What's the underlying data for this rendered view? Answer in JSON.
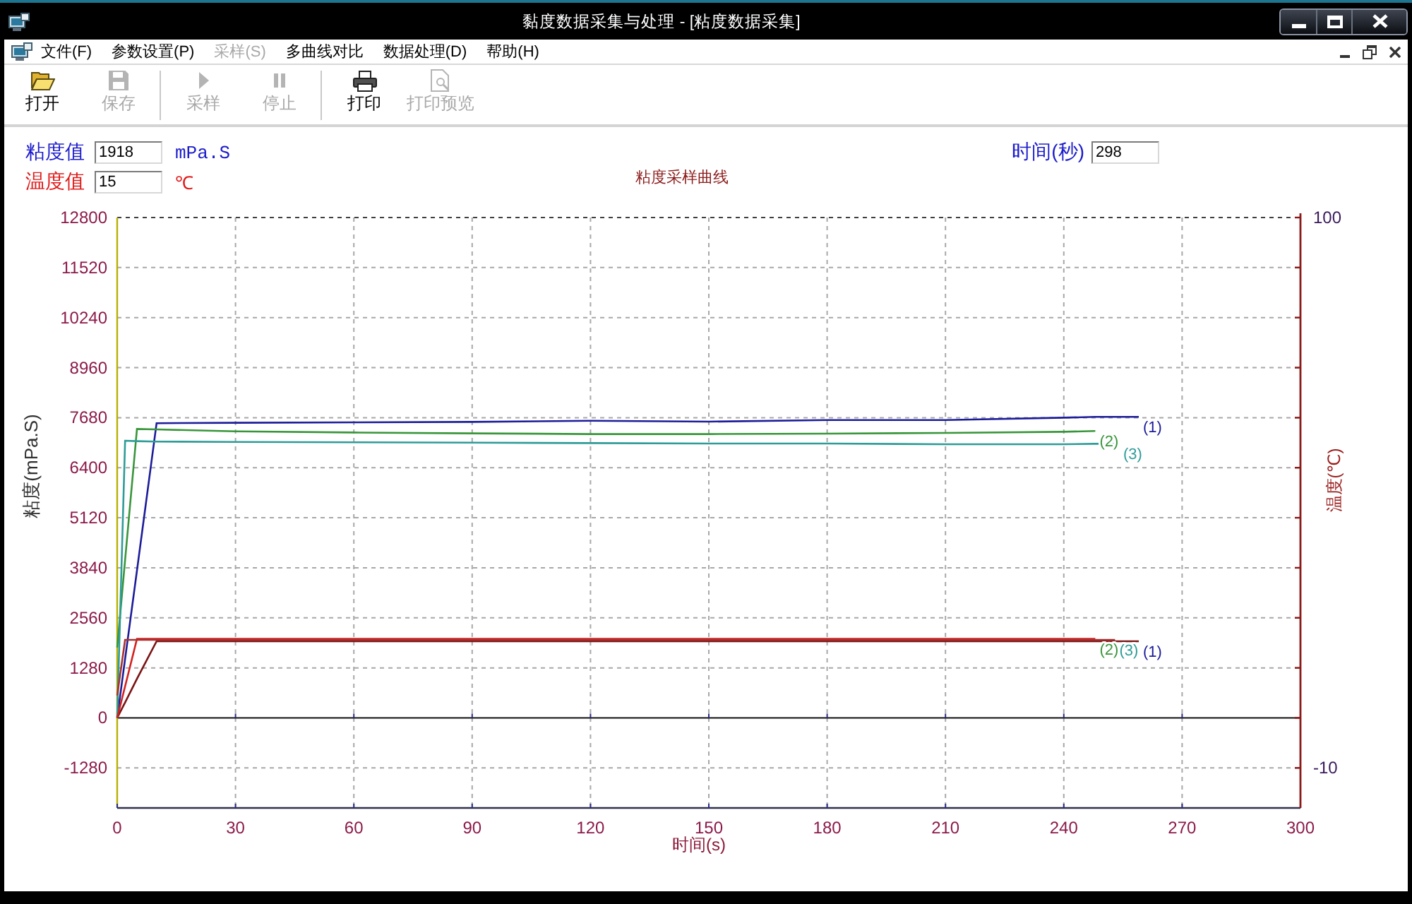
{
  "window": {
    "title": "黏度数据采集与处理 - [粘度数据采集]"
  },
  "menu_bar": {
    "items": [
      {
        "label": "文件(F)",
        "disabled": false
      },
      {
        "label": "参数设置(P)",
        "disabled": false
      },
      {
        "label": "采样(S)",
        "disabled": true
      },
      {
        "label": "多曲线对比",
        "disabled": false
      },
      {
        "label": "数据处理(D)",
        "disabled": false
      },
      {
        "label": "帮助(H)",
        "disabled": false
      }
    ]
  },
  "toolbar": {
    "items": [
      {
        "kind": "button",
        "label": "打开",
        "disabled": false
      },
      {
        "kind": "button",
        "label": "保存",
        "disabled": true
      },
      {
        "kind": "separator"
      },
      {
        "kind": "button",
        "label": "采样",
        "disabled": true
      },
      {
        "kind": "button",
        "label": "停止",
        "disabled": true
      },
      {
        "kind": "separator"
      },
      {
        "kind": "button",
        "label": "打印",
        "disabled": false
      },
      {
        "kind": "button",
        "label": "打印预览",
        "disabled": true
      }
    ]
  },
  "readings": [
    {
      "label": "粘度值",
      "value": "1918",
      "unit": "mPa.S",
      "color": "#1c1ccc"
    },
    {
      "label": "温度值",
      "value": "15",
      "unit": "℃",
      "color": "#e01818"
    }
  ],
  "time": {
    "label": "时间(秒)",
    "value": "298"
  },
  "chart": {
    "chart_data": {
      "type": "line",
      "title": "粘度采样曲线",
      "xlabel": "时间(s)",
      "ylabel": "粘度(mPa.S)",
      "y2label": "温度(℃)",
      "grid": true,
      "x": [
        0,
        2,
        5,
        10,
        30,
        60,
        90,
        120,
        150,
        180,
        210,
        240,
        248,
        253,
        254,
        259
      ],
      "xlim": [
        0,
        300
      ],
      "ylim": [
        -2304,
        12800
      ],
      "y2lim": [
        -18,
        100
      ],
      "xticks": [
        0,
        30,
        60,
        90,
        120,
        150,
        180,
        210,
        240,
        270,
        300
      ],
      "yticks": [
        -1280,
        0,
        1280,
        2560,
        3840,
        5120,
        6400,
        7680,
        8960,
        10240,
        11520,
        12800
      ],
      "y2ticks": [
        -10,
        100
      ],
      "series": [
        {
          "name": "(1)",
          "axis": "y",
          "color": "#1c1c9a",
          "values": [
            0,
            1510,
            3770,
            7540,
            7550,
            7560,
            7570,
            7600,
            7580,
            7620,
            7620,
            7680,
            7700,
            7700,
            7700,
            7700
          ]
        },
        {
          "name": "(2)",
          "axis": "y",
          "color": "#38963a",
          "values": [
            1800,
            4040,
            7390,
            7380,
            7330,
            7300,
            7280,
            7260,
            7260,
            7270,
            7290,
            7320,
            7340,
            null,
            null,
            null
          ]
        },
        {
          "name": "(3)",
          "axis": "y",
          "color": "#2e9c98",
          "values": [
            0,
            7090,
            7080,
            7070,
            7060,
            7050,
            7040,
            7030,
            7020,
            7020,
            7000,
            7000,
            7010,
            7010,
            7010,
            null
          ]
        },
        {
          "name": "(1)",
          "axis": "y2",
          "color": "#7a1414",
          "values": [
            0,
            3.1,
            7.8,
            15.3,
            15.3,
            15.3,
            15.3,
            15.3,
            15.3,
            15.3,
            15.3,
            15.3,
            15.3,
            15.3,
            15.3,
            15.3
          ]
        },
        {
          "name": "(2)",
          "axis": "y2",
          "color": "#d42020",
          "values": [
            0,
            6.3,
            15.8,
            15.8,
            15.8,
            15.8,
            15.8,
            15.8,
            15.8,
            15.8,
            15.8,
            15.8,
            15.8,
            null,
            null,
            null
          ]
        },
        {
          "name": "(3)",
          "axis": "y2",
          "color": "#a83232",
          "values": [
            4.5,
            15.6,
            15.6,
            15.6,
            15.6,
            15.6,
            15.6,
            15.6,
            15.6,
            15.6,
            15.6,
            15.6,
            15.6,
            15.6,
            null,
            null
          ]
        }
      ]
    }
  }
}
